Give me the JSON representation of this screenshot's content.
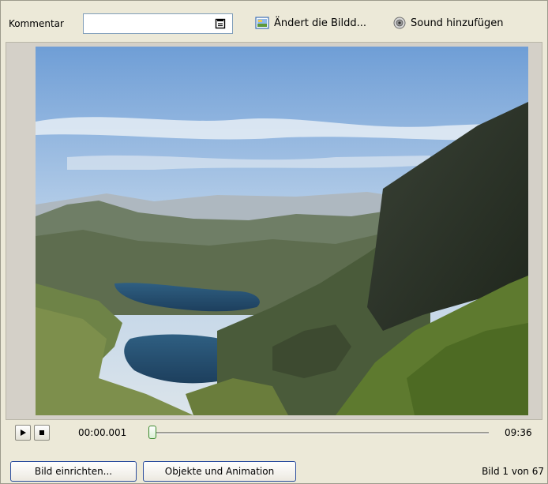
{
  "toolbar": {
    "comment_label": "Kommentar",
    "comment_value": "",
    "image_link_label": "Ändert die Bildd...",
    "sound_link_label": "Sound hinzufügen"
  },
  "playback": {
    "current_time": "00:00.001",
    "total_time": "09:36",
    "position_fraction": 0.0
  },
  "footer": {
    "setup_button": "Bild einrichten...",
    "objects_button": "Objekte und Animation",
    "image_counter": "Bild 1 von 67"
  },
  "colors": {
    "background": "#ece9d8",
    "button_border": "#2b4d9e",
    "slider_thumb": "#3b8a2e"
  },
  "icons": {
    "comment_button": "notepad-icon",
    "image_link": "image-edit-icon",
    "sound_link": "speaker-icon",
    "play": "play-icon",
    "stop": "stop-icon"
  }
}
